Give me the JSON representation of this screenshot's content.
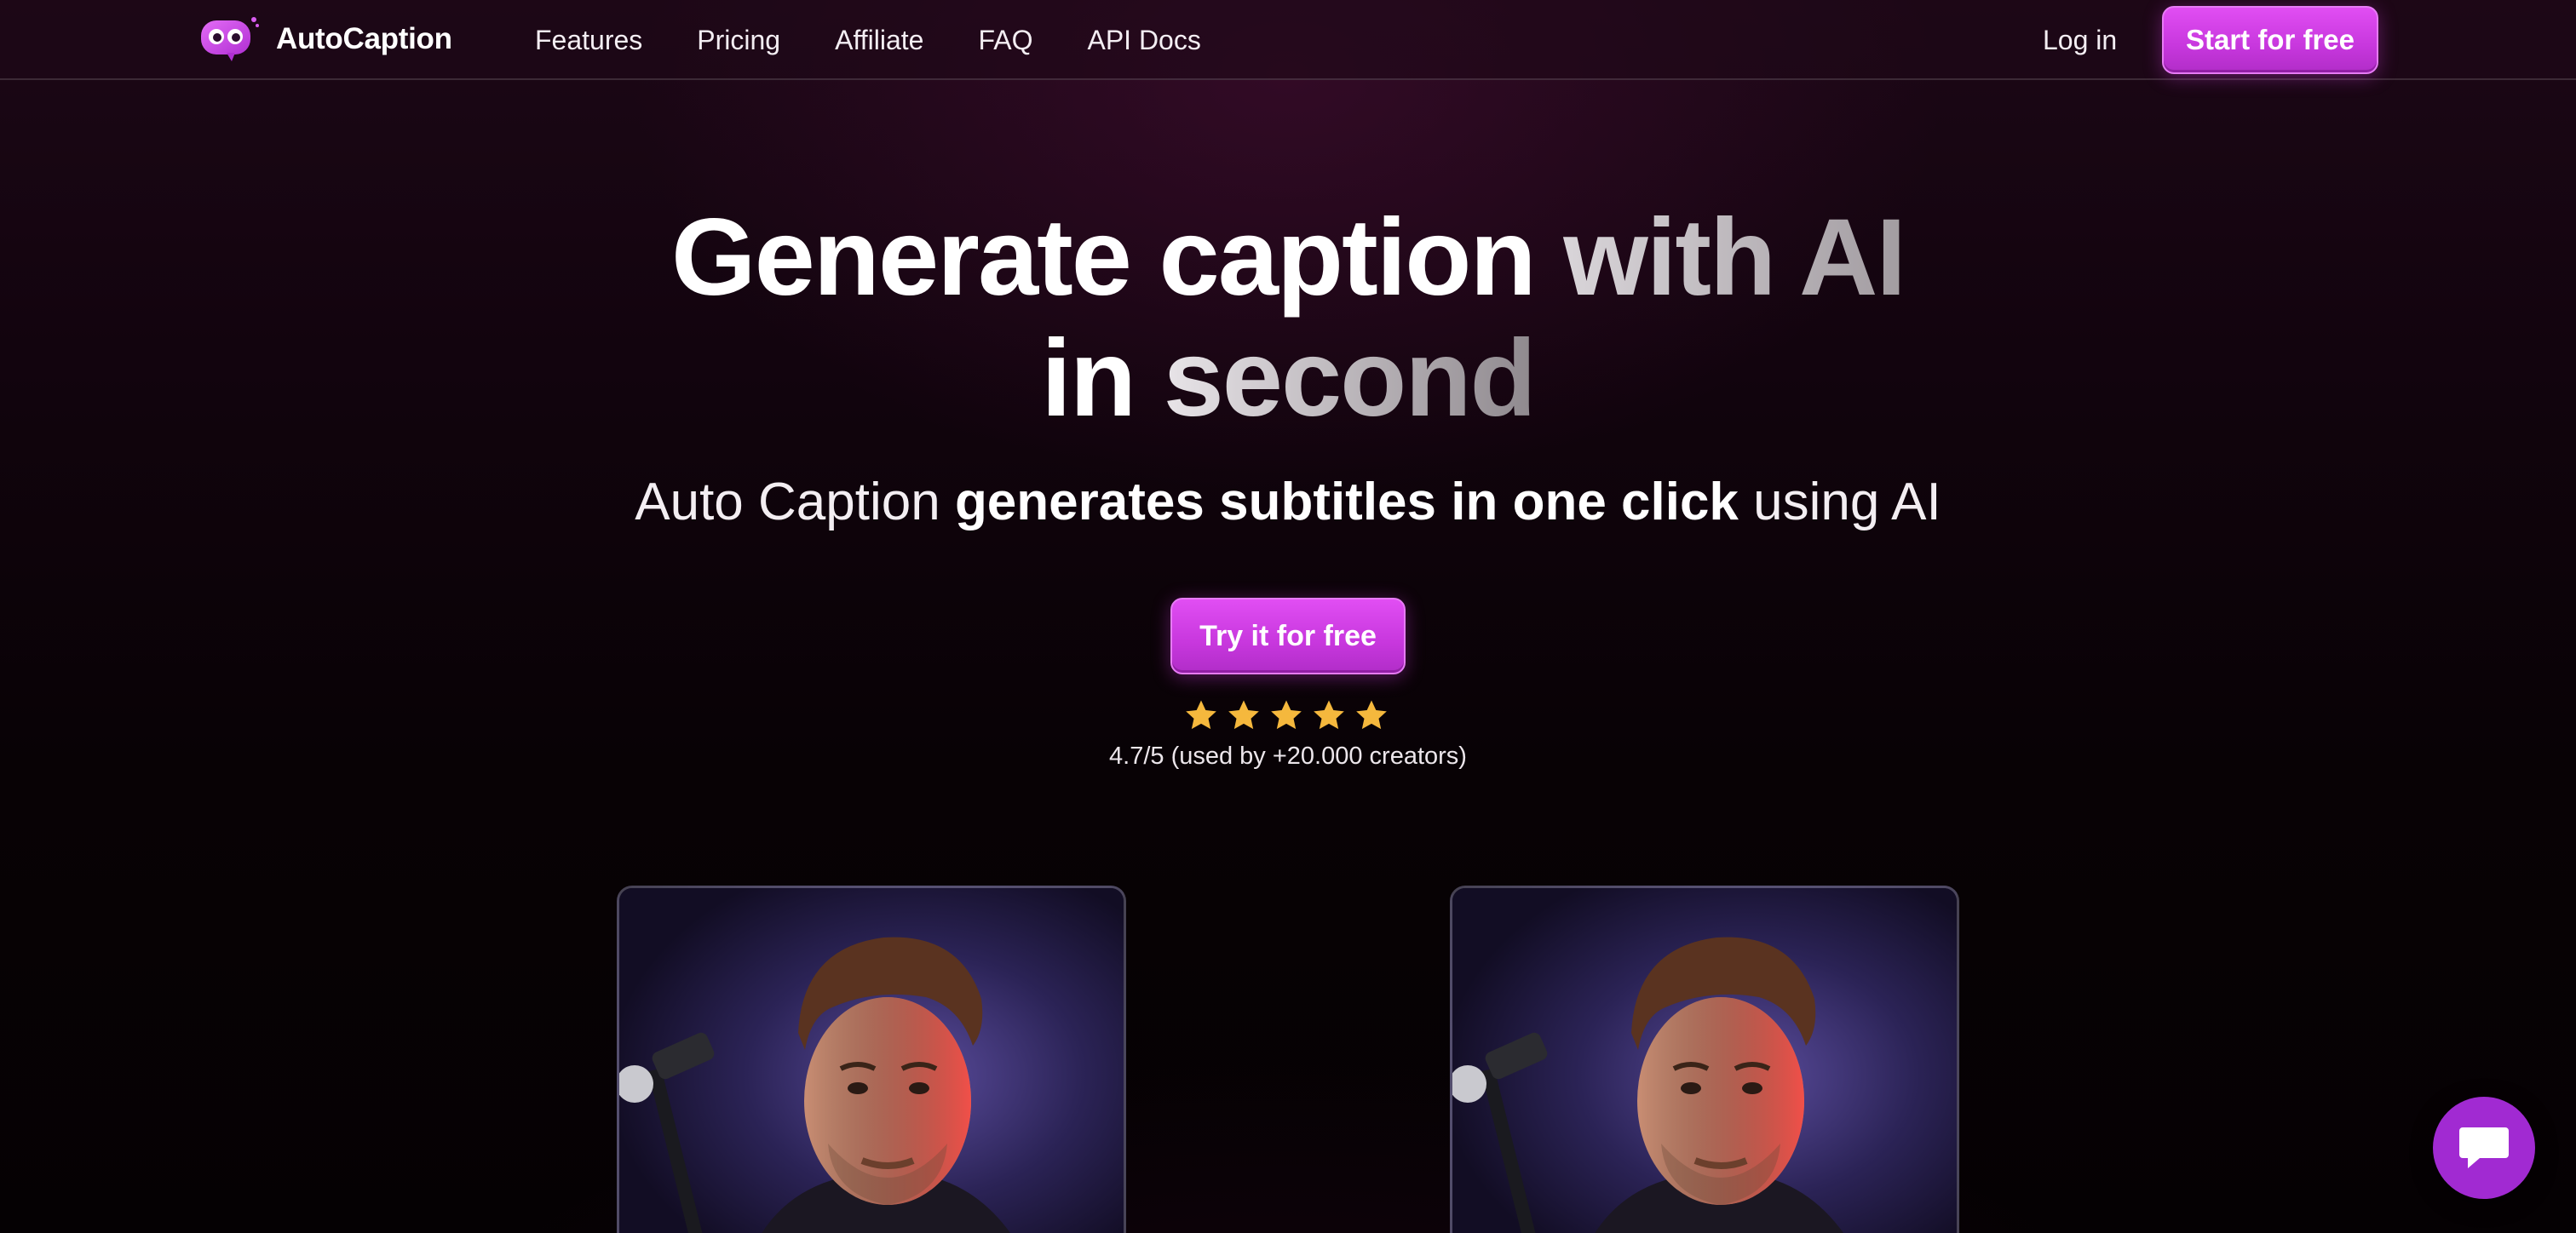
{
  "brand": {
    "name": "AutoCaption",
    "logo_icon": "robot-mascot-icon",
    "accent_color": "#d542ea"
  },
  "nav": {
    "links": [
      "Features",
      "Pricing",
      "Affiliate",
      "FAQ",
      "API Docs"
    ],
    "login_label": "Log in",
    "cta_label": "Start for free"
  },
  "hero": {
    "title_line1_white": "Generate caption",
    "title_line1_gray": "with AI",
    "title_line2_white": "in",
    "title_line2_gray": "second",
    "subtitle_pre": "Auto Caption",
    "subtitle_bold": "generates subtitles in one click",
    "subtitle_post": "using AI",
    "cta_label": "Try it for free",
    "star_count": 5,
    "star_color": "#f5b83d",
    "rating_text": "4.7/5 (used by +20.000 creators)"
  },
  "videos": {
    "left_thumbnail": "creator-video-before-thumbnail",
    "right_thumbnail": "creator-video-after-thumbnail"
  },
  "chat": {
    "icon": "chat-bubble-icon",
    "color": "#a12ad2"
  }
}
